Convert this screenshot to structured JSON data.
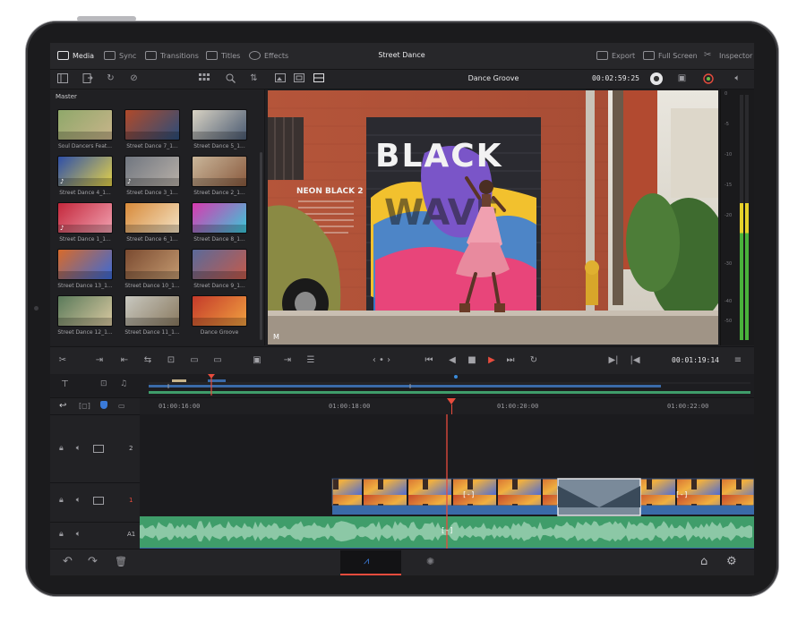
{
  "topbar": {
    "tabs": [
      {
        "label": "Media",
        "icon": "media-pool-icon",
        "active": true
      },
      {
        "label": "Sync",
        "icon": "sync-bin-icon",
        "active": false
      },
      {
        "label": "Transitions",
        "icon": "transitions-icon",
        "active": false
      },
      {
        "label": "Titles",
        "icon": "titles-icon",
        "active": false
      },
      {
        "label": "Effects",
        "icon": "effects-icon",
        "active": false
      }
    ],
    "project_title": "Street Dance",
    "right": [
      {
        "label": "Export",
        "icon": "export-icon"
      },
      {
        "label": "Full Screen",
        "icon": "full-screen-icon"
      },
      {
        "label": "Inspector",
        "icon": "inspector-icon"
      }
    ]
  },
  "viewer": {
    "clip_name": "Dance Groove",
    "timecode": "00:02:59:25"
  },
  "media_pool": {
    "bin": "Master",
    "clips": [
      {
        "name": "Soul Dancers Feat...",
        "c1": "#8fa86a",
        "c2": "#c8b48a",
        "music": false
      },
      {
        "name": "Street Dance 7_1...",
        "c1": "#b04a2a",
        "c2": "#2b4d7a",
        "music": false
      },
      {
        "name": "Street Dance 5_1...",
        "c1": "#d8d2c3",
        "c2": "#4a5a72",
        "music": false
      },
      {
        "name": "Street Dance 4_1...",
        "c1": "#2e4fa8",
        "c2": "#e4d24a",
        "music": true
      },
      {
        "name": "Street Dance 3_1...",
        "c1": "#707680",
        "c2": "#b8b0a8",
        "music": true
      },
      {
        "name": "Street Dance 2_1...",
        "c1": "#c9b69a",
        "c2": "#8a5a3e",
        "music": false
      },
      {
        "name": "Street Dance 1_1...",
        "c1": "#c4283c",
        "c2": "#f0a0b0",
        "music": true
      },
      {
        "name": "Street Dance 6_1...",
        "c1": "#d88a3a",
        "c2": "#f3e2c3",
        "music": false
      },
      {
        "name": "Street Dance 8_1...",
        "c1": "#d83ab0",
        "c2": "#3ac8d8",
        "music": false
      },
      {
        "name": "Street Dance 13_1...",
        "c1": "#d86a2a",
        "c2": "#3a6ad8",
        "music": false
      },
      {
        "name": "Street Dance 10_1...",
        "c1": "#7a4a30",
        "c2": "#c49a70",
        "music": false
      },
      {
        "name": "Street Dance 9_1...",
        "c1": "#5a6a9a",
        "c2": "#c45a4a",
        "music": false
      },
      {
        "name": "Street Dance 12_1...",
        "c1": "#5a7a5a",
        "c2": "#d8c8a0",
        "music": false
      },
      {
        "name": "Street Dance 11_1...",
        "c1": "#c8c8c0",
        "c2": "#8a7a60",
        "music": false
      },
      {
        "name": "Dance Groove",
        "c1": "#c43a2a",
        "c2": "#f0a040",
        "music": false
      }
    ]
  },
  "frame": {
    "mural_text_1": "BLACK",
    "mural_text_2": "NEON BLACK 2",
    "mural_text_3": "WAVE",
    "corner_label": "M"
  },
  "meters": {
    "scale": [
      "0",
      "-5",
      "-10",
      "-15",
      "-20",
      "-30",
      "-40",
      "-50"
    ],
    "left_level": 0.56,
    "right_level": 0.56
  },
  "transport": {
    "timecode": "00:01:19:14"
  },
  "timeline": {
    "ruler": [
      "01:00:16:00",
      "01:00:18:00",
      "01:00:20:00",
      "01:00:22:00"
    ],
    "tracks": [
      {
        "label": "2",
        "type": "video"
      },
      {
        "label": "1",
        "type": "video"
      },
      {
        "label": "A1",
        "type": "audio"
      }
    ]
  },
  "colors": {
    "accent_red": "#e84c3d",
    "clip_blue": "#3a6aa8",
    "audio_green": "#3f9d6a",
    "ui_bg": "#1f1f22"
  }
}
